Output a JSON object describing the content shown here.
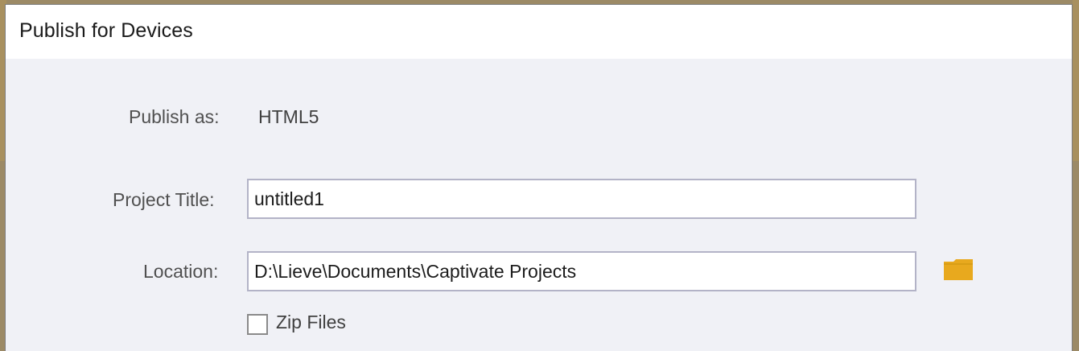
{
  "dialog": {
    "title": "Publish for Devices",
    "publish_as_label": "Publish as:",
    "publish_as_value": "HTML5",
    "project_title_label": "Project Title:",
    "project_title_value": "untitled1",
    "location_label": "Location:",
    "location_value": "D:\\Lieve\\Documents\\Captivate Projects",
    "zip_files_label": "Zip Files",
    "zip_files_checked": false,
    "folder_icon": "folder-icon",
    "folder_color": "#e8a91e"
  }
}
